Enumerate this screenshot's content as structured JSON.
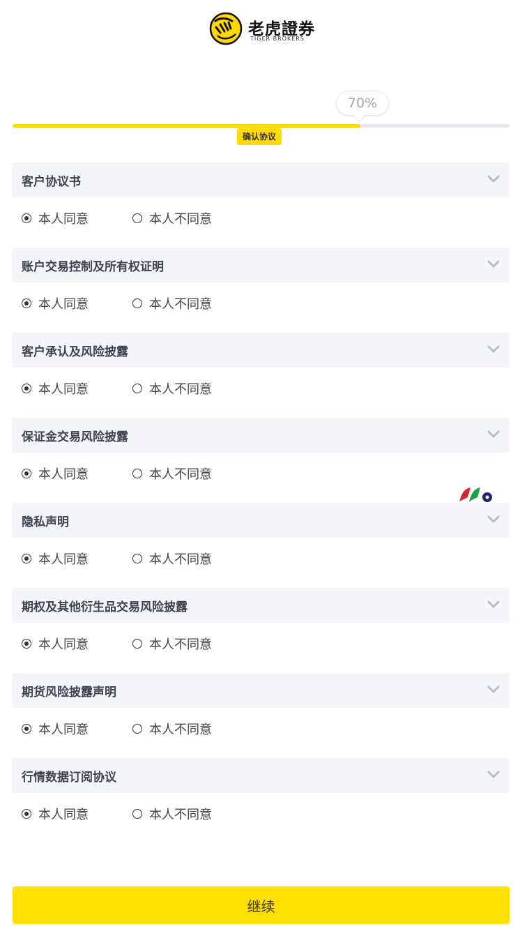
{
  "brand": {
    "name_cn": "老虎證券",
    "name_en": "TIGER BROKERS",
    "icon": "tiger-logo-icon",
    "accent_color": "#ffd900"
  },
  "progress": {
    "percent_label": "70%",
    "value": 0.7,
    "step_label": "确认协议"
  },
  "sections": [
    {
      "title": "客户协议书",
      "agree_label": "本人同意",
      "disagree_label": "本人不同意",
      "selected": "agree"
    },
    {
      "title": "账户交易控制及所有权证明",
      "agree_label": "本人同意",
      "disagree_label": "本人不同意",
      "selected": "agree"
    },
    {
      "title": "客户承认及风险披露",
      "agree_label": "本人同意",
      "disagree_label": "本人不同意",
      "selected": "agree"
    },
    {
      "title": "保证金交易风险披露",
      "agree_label": "本人同意",
      "disagree_label": "本人不同意",
      "selected": "agree"
    },
    {
      "title": "隐私声明",
      "agree_label": "本人同意",
      "disagree_label": "本人不同意",
      "selected": "agree"
    },
    {
      "title": "期权及其他衍生品交易风险披露",
      "agree_label": "本人同意",
      "disagree_label": "本人不同意",
      "selected": "agree"
    },
    {
      "title": "期货风险披露声明",
      "agree_label": "本人同意",
      "disagree_label": "本人不同意",
      "selected": "agree"
    },
    {
      "title": "行情数据订阅协议",
      "agree_label": "本人同意",
      "disagree_label": "本人不同意",
      "selected": "agree"
    }
  ],
  "continue_label": "继续"
}
